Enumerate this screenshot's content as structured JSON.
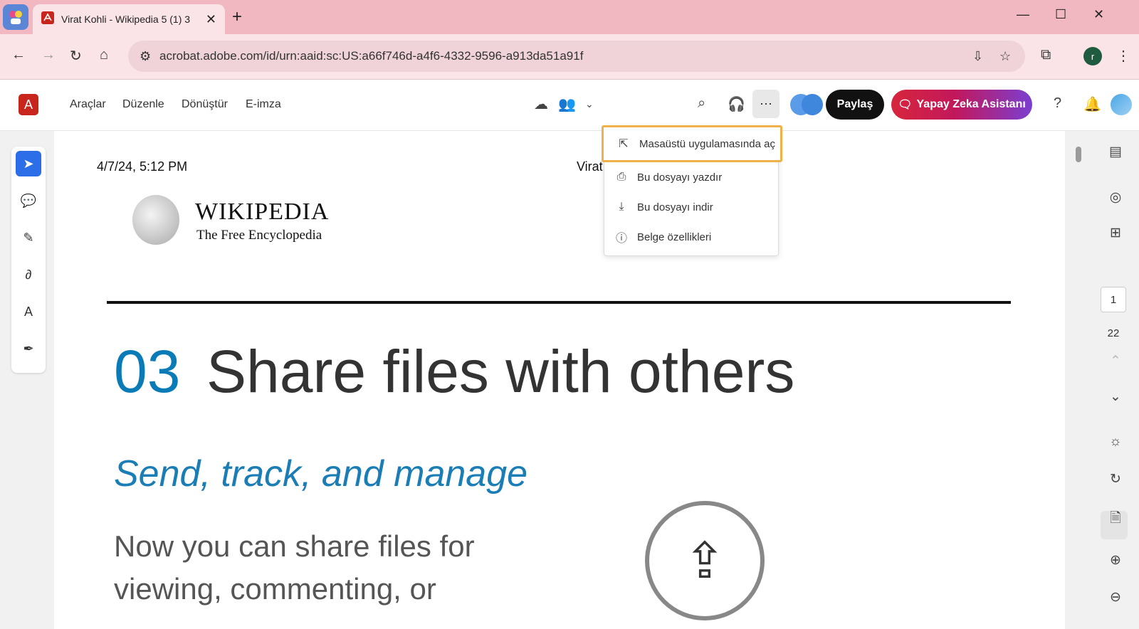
{
  "browser": {
    "tab_title": "Virat Kohli - Wikipedia 5 (1) 3",
    "url": "acrobat.adobe.com/id/urn:aaid:sc:US:a66f746d-a4f6-4332-9596-a913da51a91f",
    "profile_initial": "r"
  },
  "toolbar": {
    "menu": [
      "Araçlar",
      "Düzenle",
      "Dönüştür",
      "E-imza"
    ],
    "share_label": "Paylaş",
    "ai_label": "Yapay Zeka Asistanı"
  },
  "dropdown": {
    "items": [
      {
        "label": "Masaüstü uygulamasında aç",
        "icon": "open-external-icon"
      },
      {
        "label": "Bu dosyayı yazdır",
        "icon": "print-icon"
      },
      {
        "label": "Bu dosyayı indir",
        "icon": "download-icon"
      },
      {
        "label": "Belge özellikleri",
        "icon": "info-icon"
      }
    ]
  },
  "document": {
    "date": "4/7/24, 5:12 PM",
    "title_cut": "Virat",
    "wiki_name": "WIKIPEDIA",
    "wiki_tagline": "The Free Encyclopedia",
    "section_number": "03",
    "section_title": "Share files with others",
    "subtitle": "Send, track, and manage",
    "body_lines": [
      "Now you can share files for",
      "viewing, commenting, or"
    ]
  },
  "pagination": {
    "current": "1",
    "total": "22"
  },
  "colors": {
    "accent_blue": "#2c6ee8",
    "adobe_red": "#c8251d",
    "highlight": "#f0b04a",
    "section_blue": "#0b7bb8"
  }
}
